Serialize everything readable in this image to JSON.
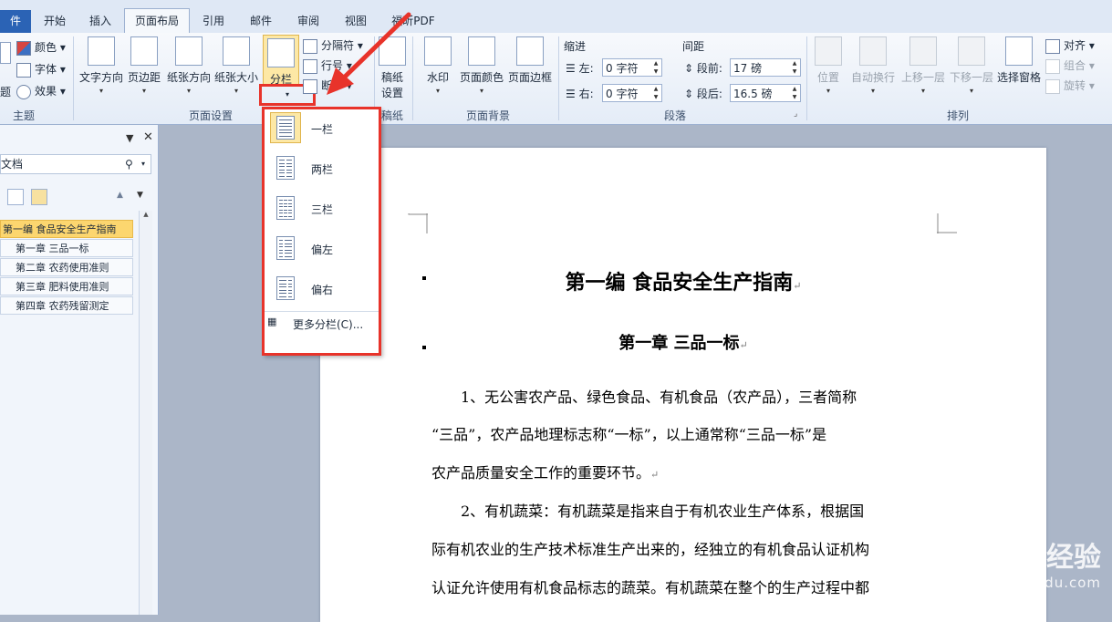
{
  "title_bar": {
    "text": ""
  },
  "tabs": [
    {
      "label": "件",
      "active": false,
      "file": true
    },
    {
      "label": "开始",
      "active": false
    },
    {
      "label": "插入",
      "active": false
    },
    {
      "label": "页面布局",
      "active": true
    },
    {
      "label": "引用",
      "active": false
    },
    {
      "label": "邮件",
      "active": false
    },
    {
      "label": "审阅",
      "active": false
    },
    {
      "label": "视图",
      "active": false
    },
    {
      "label": "福昕PDF",
      "active": false
    }
  ],
  "ribbon": {
    "theme": {
      "colors": "颜色",
      "fonts": "字体",
      "effects": "效果",
      "left_label": "题",
      "group_label": "主题"
    },
    "page_setup": {
      "text_direction": "文字方向",
      "margins": "页边距",
      "orientation": "纸张方向",
      "size": "纸张大小",
      "columns": "分栏",
      "breaks": "分隔符",
      "line_numbers": "行号",
      "hyphenation": "断字",
      "group_label": "页面设置"
    },
    "draft": {
      "draft_settings_1": "稿纸",
      "draft_settings_2": "设置",
      "group_label": "稿纸"
    },
    "background": {
      "watermark": "水印",
      "page_color": "页面颜色",
      "page_borders": "页面边框",
      "group_label": "页面背景"
    },
    "paragraph": {
      "indent_title": "缩进",
      "spacing_title": "间距",
      "left_label": "左:",
      "left_value": "0 字符",
      "right_label": "右:",
      "right_value": "0 字符",
      "before_label": "段前:",
      "before_value": "17 磅",
      "after_label": "段后:",
      "after_value": "16.5 磅",
      "group_label": "段落"
    },
    "arrange": {
      "position": "位置",
      "wrap_text": "自动换行",
      "bring_forward": "上移一层",
      "send_backward": "下移一层",
      "selection_pane": "选择窗格",
      "align": "对齐",
      "group": "组合",
      "rotate": "旋转",
      "group_label": "排列"
    }
  },
  "nav_pane": {
    "search_text": "文档",
    "items": [
      {
        "label": "第一编 食品安全生产指南",
        "selected": true
      },
      {
        "label": "第一章 三品一标",
        "selected": false
      },
      {
        "label": "第二章 农药使用准则",
        "selected": false
      },
      {
        "label": "第三章 肥料使用准则",
        "selected": false
      },
      {
        "label": "第四章 农药残留测定",
        "selected": false
      }
    ]
  },
  "columns_dropdown": {
    "items": [
      {
        "label": "一栏",
        "selected": true
      },
      {
        "label": "两栏",
        "selected": false
      },
      {
        "label": "三栏",
        "selected": false
      },
      {
        "label": "偏左",
        "selected": false
      },
      {
        "label": "偏右",
        "selected": false
      }
    ],
    "more": "更多分栏(C)..."
  },
  "document": {
    "heading1": "第一编  食品安全生产指南",
    "heading2": "第一章  三品一标",
    "lines": [
      "　　1、无公害农产品、绿色食品、有机食品（农产品），三者简称",
      "“三品”，农产品地理标志称“一标”，以上通常称“三品一标”是",
      "农产品质量安全工作的重要环节。",
      "　　2、有机蔬菜：有机蔬菜是指来自于有机农业生产体系，根据国",
      "际有机农业的生产技术标准生产出来的，经独立的有机食品认证机构",
      "认证允许使用有机食品标志的蔬菜。有机蔬菜在整个的生产过程中都"
    ],
    "para_mark": "↵"
  },
  "watermark": {
    "main": "Bai 经验",
    "sub": "jingyan.baidu.com"
  },
  "colors": {
    "accent_red": "#e8332a",
    "file_tab": "#2b63b5",
    "selected_nav": "#fcd66f"
  }
}
